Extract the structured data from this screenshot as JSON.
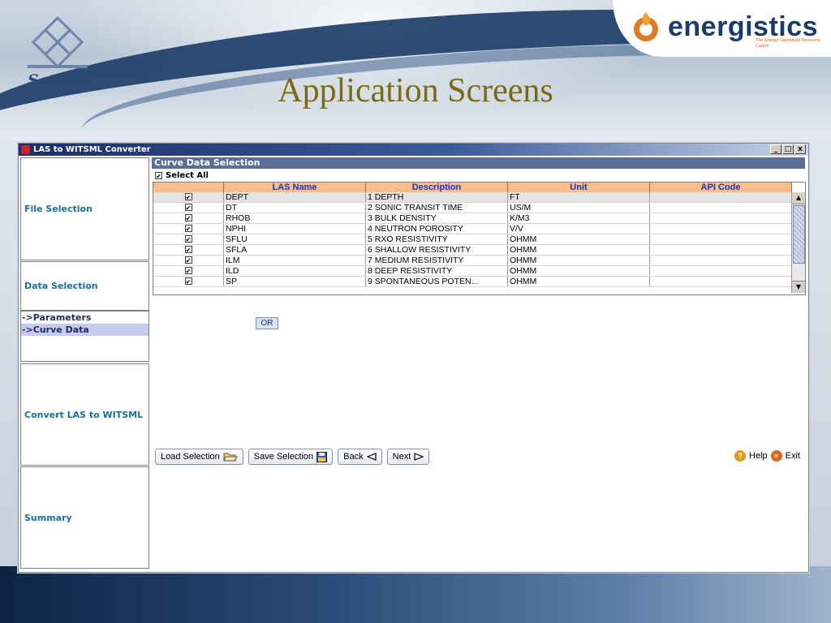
{
  "slide": {
    "title": "Application Screens",
    "logo_left_text": "Satyam",
    "logo_right_text": "energistics",
    "logo_right_tagline": "The Energy Standards Resource Centre"
  },
  "window": {
    "title": "LAS to WITSML Converter",
    "controls": [
      "_",
      "□",
      "x"
    ]
  },
  "sidebar": {
    "file_selection": "File Selection",
    "data_selection": "Data Selection",
    "sub_items": [
      "->Parameters",
      "->Curve Data"
    ],
    "convert": "Convert LAS to WITSML",
    "summary": "Summary"
  },
  "curve_section": {
    "header": "Curve Data Selection",
    "select_all_label": "Select All",
    "select_all_checked": true,
    "columns": [
      "",
      "LAS Name",
      "Description",
      "Unit",
      "API Code"
    ],
    "rows": [
      {
        "checked": true,
        "las": "DEPT",
        "desc": "1  DEPTH",
        "unit": "FT",
        "api": ""
      },
      {
        "checked": true,
        "las": "DT",
        "desc": "2  SONIC TRANSIT TIME",
        "unit": "US/M",
        "api": ""
      },
      {
        "checked": true,
        "las": "RHOB",
        "desc": "3  BULK DENSITY",
        "unit": "K/M3",
        "api": ""
      },
      {
        "checked": true,
        "las": "NPHI",
        "desc": "4   NEUTRON POROSITY",
        "unit": "V/V",
        "api": ""
      },
      {
        "checked": true,
        "las": "SFLU",
        "desc": "5  RXO RESISTIVITY",
        "unit": "OHMM",
        "api": ""
      },
      {
        "checked": true,
        "las": "SFLA",
        "desc": "6  SHALLOW RESISTIVITY",
        "unit": "OHMM",
        "api": ""
      },
      {
        "checked": true,
        "las": "ILM",
        "desc": "7  MEDIUM RESISTIVITY",
        "unit": "OHMM",
        "api": ""
      },
      {
        "checked": true,
        "las": "ILD",
        "desc": "8  DEEP RESISTIVITY",
        "unit": "OHMM",
        "api": ""
      },
      {
        "checked": true,
        "las": "SP",
        "desc": "9  SPONTANEOUS POTEN...",
        "unit": "OHMM",
        "api": ""
      }
    ],
    "or_button": "OR"
  },
  "buttons": {
    "load": "Load Selection",
    "save": "Save Selection",
    "back": "Back",
    "next": "Next",
    "help": "Help",
    "exit": "Exit"
  }
}
